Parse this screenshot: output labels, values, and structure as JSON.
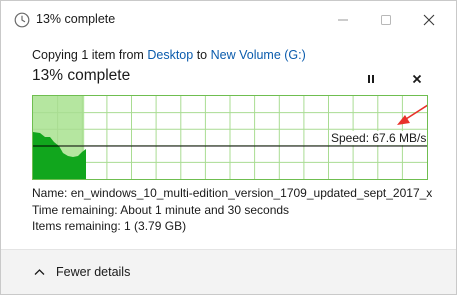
{
  "window": {
    "title": "13% complete"
  },
  "progress": {
    "percent": 13,
    "heading": "13% complete",
    "copy_prefix": "Copying 1 item from",
    "source": "Desktop",
    "copy_to": "to",
    "destination": "New Volume (G:)",
    "speed_label": "Speed: 67.6 MB/s"
  },
  "details": {
    "name_label": "Name:",
    "name_value": "en_windows_10_multi-edition_version_1709_updated_sept_2017_x...",
    "time_label": "Time remaining:",
    "time_value": "About 1 minute and 30 seconds",
    "items_label": "Items remaining:",
    "items_value": "1 (3.79 GB)"
  },
  "footer": {
    "toggle_label": "Fewer details"
  },
  "colors": {
    "graph_fill_light": "#b5e6a0",
    "graph_fill_dark": "#11a61d",
    "graph_border": "#6fbe50",
    "link": "#0b5cad",
    "arrow": "#e8312a"
  },
  "icons": {
    "title": "clock-icon",
    "pause": "pause-icon",
    "stop": "close-icon",
    "toggle": "chevron-up-icon"
  }
}
